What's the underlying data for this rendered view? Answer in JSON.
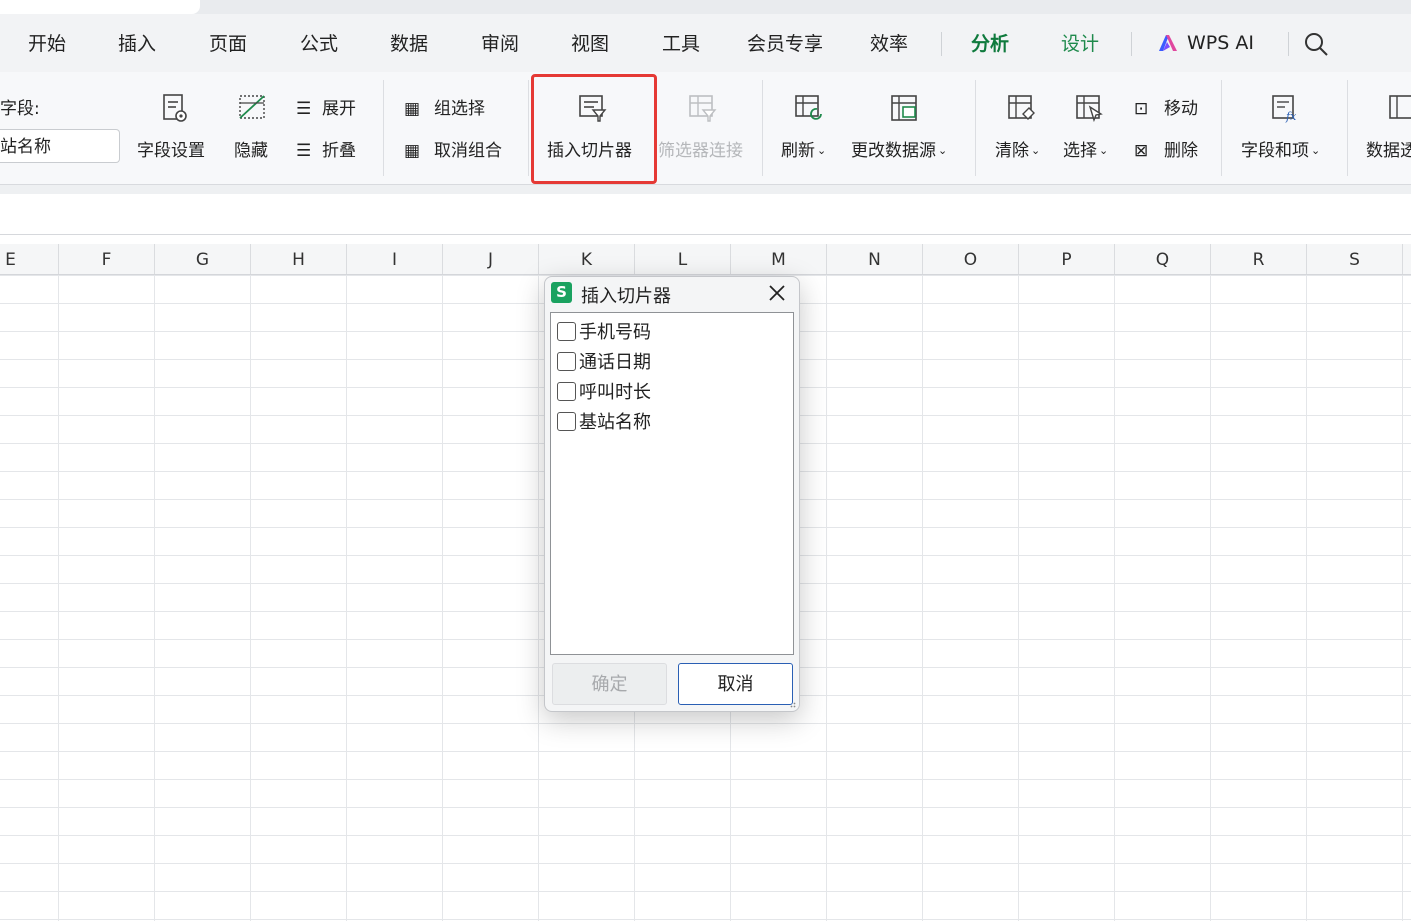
{
  "menu": {
    "items": [
      "开始",
      "插入",
      "页面",
      "公式",
      "数据",
      "审阅",
      "视图",
      "工具",
      "会员专享",
      "效率",
      "分析",
      "设计"
    ],
    "active": "分析",
    "ai_label": "WPS AI"
  },
  "ribbon": {
    "field_label": "字段:",
    "field_value": "站名称",
    "field_settings": "字段设置",
    "hide": "隐藏",
    "expand": "展开",
    "collapse": "折叠",
    "group_select": "组选择",
    "ungroup": "取消组合",
    "insert_slicer": "插入切片器",
    "filter_connect": "筛选器连接",
    "refresh": "刷新",
    "change_source": "更改数据源",
    "clear": "清除",
    "select": "选择",
    "move": "移动",
    "delete": "删除",
    "fields_items": "字段和项",
    "data_cut": "数据透"
  },
  "grid": {
    "columns": [
      "E",
      "F",
      "G",
      "H",
      "I",
      "J",
      "K",
      "L",
      "M",
      "N",
      "O",
      "P",
      "Q",
      "R",
      "S"
    ]
  },
  "dialog": {
    "app_icon": "S",
    "title": "插入切片器",
    "fields": [
      "手机号码",
      "通话日期",
      "呼叫时长",
      "基站名称"
    ],
    "ok_label": "确定",
    "cancel_label": "取消"
  },
  "colors": {
    "accent": "#0f7a3d",
    "highlight": "#e53935",
    "app_icon_bg": "#1aa260"
  }
}
